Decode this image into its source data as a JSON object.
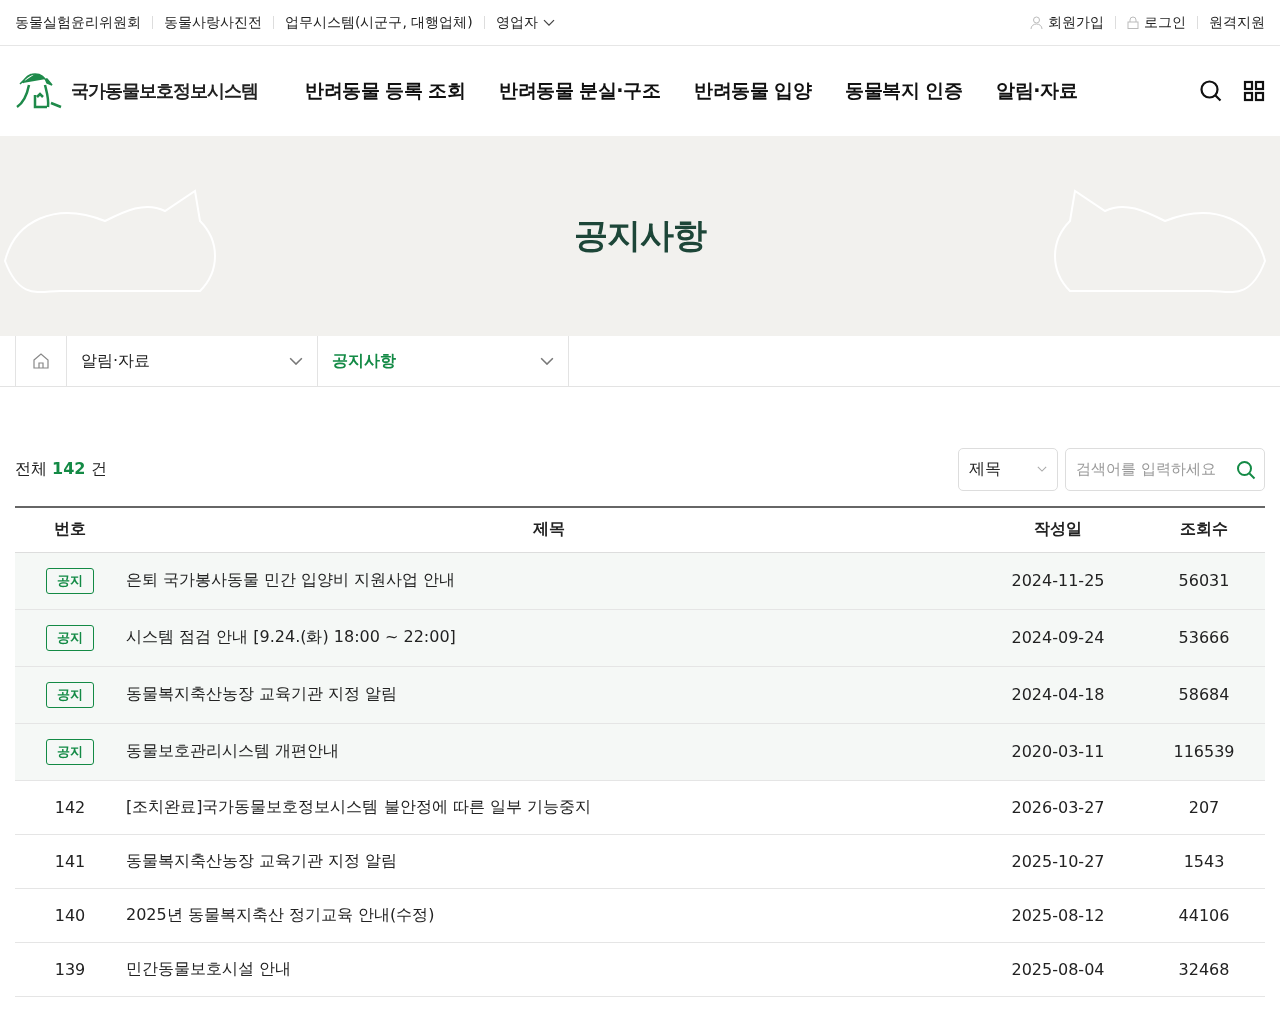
{
  "utility_bar": {
    "left_links": [
      "동물실험윤리위원회",
      "동물사랑사진전",
      "업무시스템(시군구, 대행업체)"
    ],
    "dropdown": "영업자",
    "right_links": [
      {
        "kind": "user",
        "label": "회원가입"
      },
      {
        "kind": "lock",
        "label": "로그인"
      },
      {
        "kind": "plain",
        "label": "원격지원"
      }
    ]
  },
  "header": {
    "logo_text": "국가동물보호정보시스템",
    "nav": [
      "반려동물 등록 조회",
      "반려동물 분실·구조",
      "반려동물 입양",
      "동물복지 인증",
      "알림·자료"
    ]
  },
  "hero": {
    "title": "공지사항"
  },
  "breadcrumb": [
    {
      "label": "알림·자료",
      "selected": false
    },
    {
      "label": "공지사항",
      "selected": true
    }
  ],
  "board": {
    "total_prefix": "전체",
    "total_count": "142",
    "total_suffix": "건",
    "search_select": "제목",
    "search_placeholder": "검색어를 입력하세요",
    "columns": [
      "번호",
      "제목",
      "작성일",
      "조회수"
    ],
    "rows": [
      {
        "kind": "notice",
        "number": "공지",
        "title": "은퇴 국가봉사동물 민간 입양비 지원사업 안내",
        "date": "2024-11-25",
        "views": "56031"
      },
      {
        "kind": "notice",
        "number": "공지",
        "title": "시스템 점검 안내 [9.24.(화) 18:00 ~ 22:00]",
        "date": "2024-09-24",
        "views": "53666"
      },
      {
        "kind": "notice",
        "number": "공지",
        "title": "동물복지축산농장 교육기관 지정 알림",
        "date": "2024-04-18",
        "views": "58684"
      },
      {
        "kind": "notice",
        "number": "공지",
        "title": "동물보호관리시스템 개편안내",
        "date": "2020-03-11",
        "views": "116539"
      },
      {
        "kind": "post",
        "number": "142",
        "title": "[조치완료]국가동물보호정보시스템 불안정에 따른 일부 기능중지",
        "date": "2026-03-27",
        "views": "207"
      },
      {
        "kind": "post",
        "number": "141",
        "title": "동물복지축산농장 교육기관 지정 알림",
        "date": "2025-10-27",
        "views": "1543"
      },
      {
        "kind": "post",
        "number": "140",
        "title": "2025년 동물복지축산 정기교육 안내(수정)",
        "date": "2025-08-12",
        "views": "44106"
      },
      {
        "kind": "post",
        "number": "139",
        "title": "민간동물보호시설 안내",
        "date": "2025-08-04",
        "views": "32468"
      }
    ]
  }
}
